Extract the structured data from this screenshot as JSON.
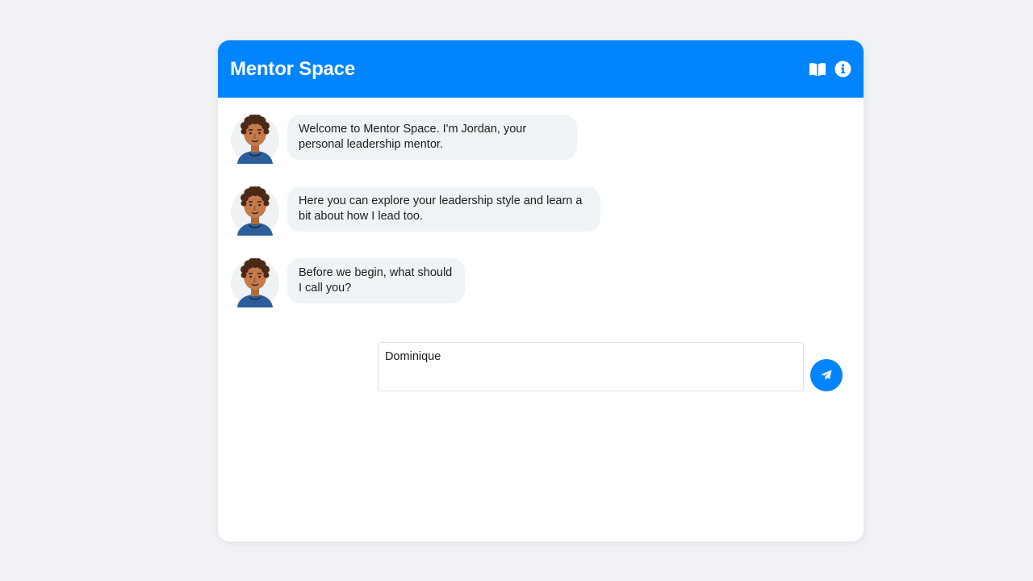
{
  "header": {
    "title": "Mentor Space",
    "icons": [
      "book-icon",
      "info-icon"
    ]
  },
  "colors": {
    "brand": "#0084ff",
    "bubble_bg": "#eff3f5",
    "page_bg": "#f0f2f5"
  },
  "messages": [
    {
      "sender": "mentor",
      "text": "Welcome to Mentor Space. I'm Jordan, your personal leadership mentor."
    },
    {
      "sender": "mentor",
      "text": "Here you can explore your leadership style and learn a bit about how I lead too."
    },
    {
      "sender": "mentor",
      "text": "Before we begin, what should I call you?"
    }
  ],
  "composer": {
    "value": "Dominique",
    "send_icon": "paper-plane-icon"
  }
}
